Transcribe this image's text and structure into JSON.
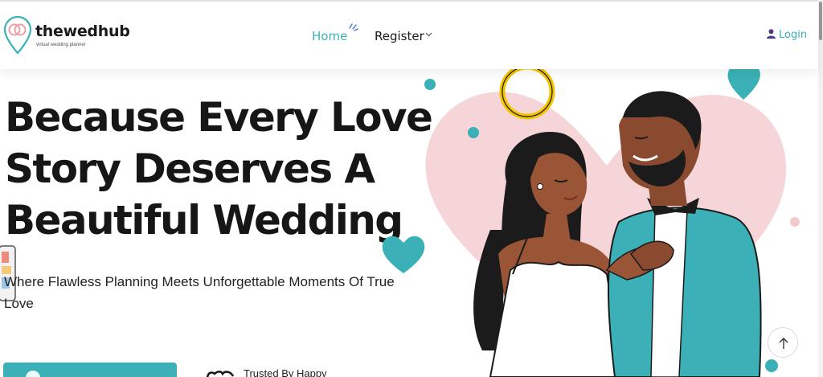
{
  "brand": {
    "name": "thewedhub",
    "tagline": "virtual wedding planner",
    "accent": "#3bb1b7"
  },
  "nav": {
    "home": "Home",
    "register": "Register",
    "login": "Login"
  },
  "icons": {
    "logo": "map-pin-rings-icon",
    "register_caret": "chevron-down-icon",
    "login": "user-icon",
    "back_to_top": "arrow-up-icon"
  },
  "hero": {
    "title_lines": [
      "Because Every Love",
      "Story Deserves A",
      "Beautiful Wedding"
    ],
    "subtitle": "Where Flawless Planning Meets Unforgettable Moments Of True Love",
    "trusted_text": "Trusted By Happy"
  },
  "colors": {
    "teal": "#3bb1b7",
    "pink_heart": "#f6d5d8",
    "ring_gold": "#f2c400",
    "text": "#161616"
  }
}
